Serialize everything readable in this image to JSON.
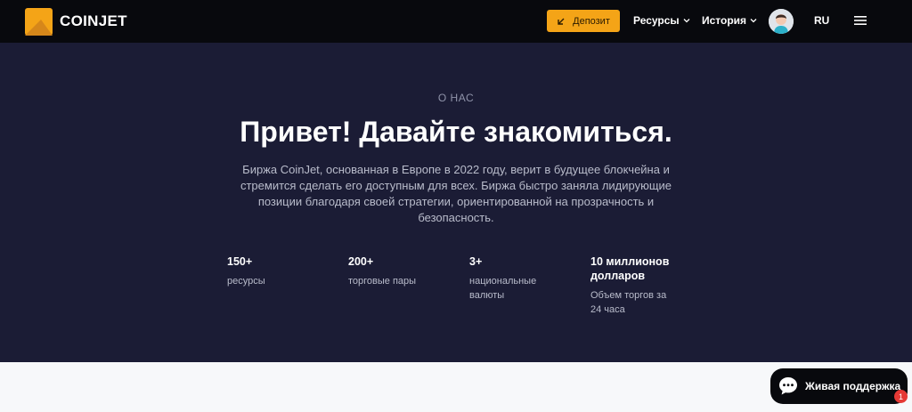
{
  "header": {
    "logo_text": "COINJET",
    "deposit_label": "Депозит",
    "nav": [
      {
        "label": "Ресурсы"
      },
      {
        "label": "История"
      }
    ],
    "language": "RU",
    "icons": {
      "logo": "coinjet-logo-icon",
      "deposit": "arrow-down-left-icon",
      "chevron": "chevron-down-icon",
      "avatar": "user-avatar",
      "menu": "hamburger-menu-icon"
    }
  },
  "hero": {
    "eyebrow": "О НАС",
    "title": "Привет! Давайте знакомиться.",
    "description": "Биржа CoinJet, основанная в Европе в 2022 году, верит в будущее блокчейна и стремится сделать его доступным для всех. Биржа быстро заняла лидирующие позиции благодаря своей стратегии, ориентированной на прозрачность и безопасность.",
    "stats": [
      {
        "value": "150+",
        "label": "ресурсы"
      },
      {
        "value": "200+",
        "label": "торговые пары"
      },
      {
        "value": "3+",
        "label": "национальные валюты"
      },
      {
        "value": "10 миллионов долларов",
        "label": "Объем торгов за 24 часа"
      }
    ]
  },
  "support": {
    "label": "Живая поддержка",
    "badge": "1",
    "icon": "chat-bubble-icon"
  },
  "colors": {
    "header_bg": "#08090d",
    "hero_bg": "#1b1c35",
    "accent": "#f4a417",
    "page_bg": "#f7f8fa"
  }
}
